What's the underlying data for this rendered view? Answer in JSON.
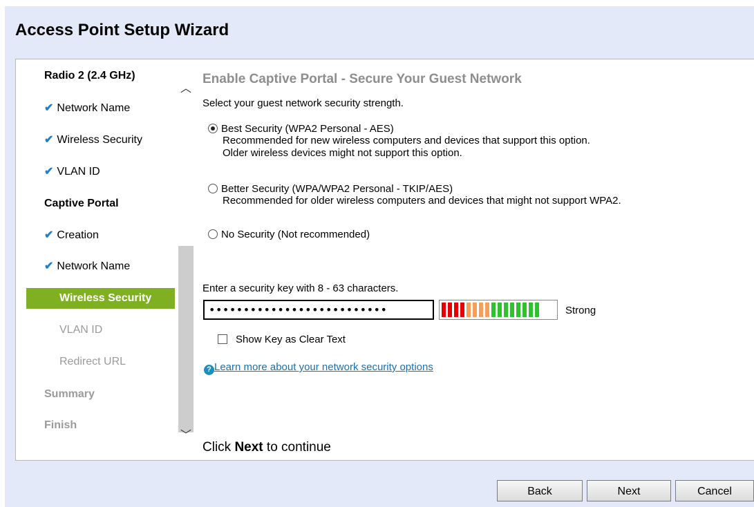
{
  "wizard": {
    "title": "Access Point Setup Wizard"
  },
  "sidebar": {
    "items": [
      {
        "label": "Radio 2 (2.4 GHz)",
        "state": "header"
      },
      {
        "label": "Network Name",
        "state": "done",
        "icon": "checkmark-icon"
      },
      {
        "label": "Wireless Security",
        "state": "done",
        "icon": "checkmark-icon"
      },
      {
        "label": "VLAN ID",
        "state": "done",
        "icon": "checkmark-icon"
      },
      {
        "label": "Captive Portal",
        "state": "header"
      },
      {
        "label": "Creation",
        "state": "done",
        "icon": "checkmark-icon"
      },
      {
        "label": "Network Name",
        "state": "done",
        "icon": "checkmark-icon"
      },
      {
        "label": "Wireless Security",
        "state": "active"
      },
      {
        "label": "VLAN ID",
        "state": "disabled"
      },
      {
        "label": "Redirect URL",
        "state": "disabled"
      },
      {
        "label": "Summary",
        "state": "disabled-header"
      },
      {
        "label": "Finish",
        "state": "disabled-header"
      }
    ],
    "check_glyph": "✔"
  },
  "main": {
    "section_title": "Enable Captive Portal - Secure Your Guest Network",
    "subtitle": "Select your guest network security strength.",
    "options": [
      {
        "label": "Best Security (WPA2 Personal - AES)",
        "checked": true,
        "desc": [
          "Recommended for new wireless computers and devices that support this option.",
          "Older wireless devices might not support this option."
        ]
      },
      {
        "label": "Better Security (WPA/WPA2 Personal - TKIP/AES)",
        "checked": false,
        "desc": [
          "Recommended for older wireless computers and devices that might not support WPA2."
        ]
      },
      {
        "label": "No Security (Not recommended)",
        "checked": false,
        "desc": []
      }
    ],
    "key_label": "Enter a security key with 8 - 63 characters.",
    "key_value": "••••••••••••••••••••••••••",
    "strength_label": "Strong",
    "strength_colors": [
      "#e60000",
      "#e60000",
      "#e60000",
      "#e60000",
      "#f5a05a",
      "#f5a05a",
      "#f5a05a",
      "#f5a05a",
      "#2ec32e",
      "#2ec32e",
      "#2ec32e",
      "#2ec32e",
      "#2ec32e",
      "#2ec32e",
      "#2ec32e",
      "#2ec32e"
    ],
    "show_key_label": "Show Key as Clear Text",
    "help_icon": "?",
    "help_link": "Learn more about your network security options",
    "continue_prefix": "Click ",
    "continue_bold": "Next",
    "continue_suffix": " to continue"
  },
  "footer": {
    "back_label": "Back",
    "next_label": "Next",
    "cancel_label": "Cancel"
  },
  "scroll": {
    "up_glyph": "︿",
    "down_glyph": "﹀"
  }
}
